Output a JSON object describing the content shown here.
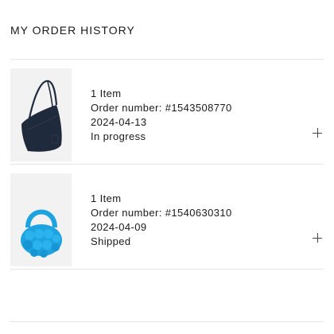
{
  "page": {
    "title": "MY ORDER HISTORY"
  },
  "orders": [
    {
      "item_count": "1 Item",
      "order_number": "Order number: #1543508770",
      "date": "2024-04-13",
      "status": "In progress",
      "product_icon": "navy-shoulder-bag",
      "product_color": "#1f2a3c"
    },
    {
      "item_count": "1 Item",
      "order_number": "Order number: #1540630310",
      "date": "2024-04-09",
      "status": "Shipped",
      "product_icon": "blue-quilted-bag",
      "product_color": "#1fa3e0"
    }
  ],
  "icons": {
    "expand": "plus-icon"
  },
  "colors": {
    "text": "#1a1a1a",
    "divider": "#e6e6e6",
    "thumb_background": "#f2f2f2"
  }
}
